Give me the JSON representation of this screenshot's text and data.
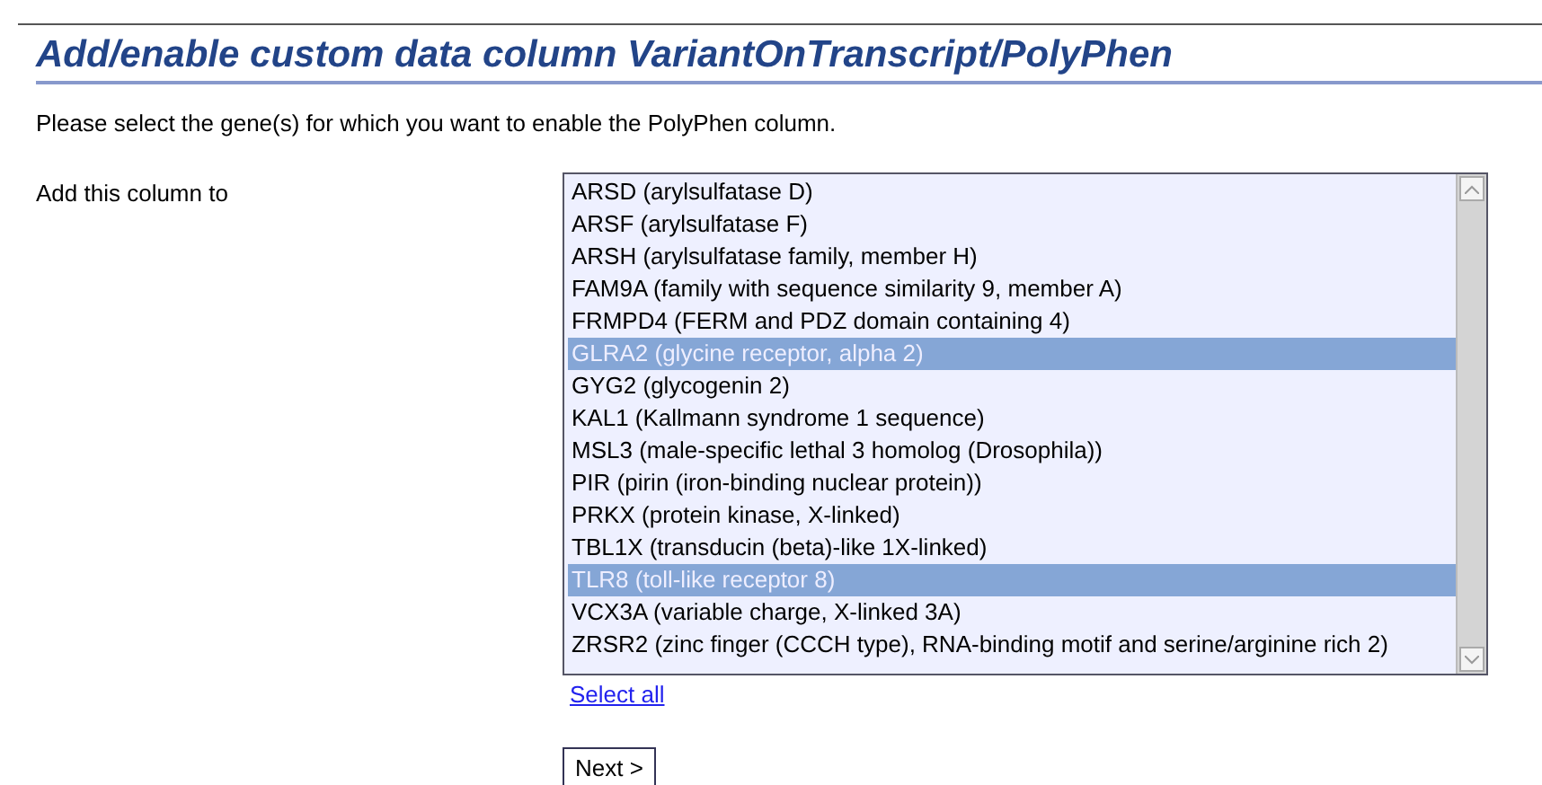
{
  "title": "Add/enable custom data column VariantOnTranscript/PolyPhen",
  "intro": "Please select the gene(s) for which you want to enable the PolyPhen column.",
  "field_label": "Add this column to",
  "genes": [
    {
      "label": "ARSD (arylsulfatase D)",
      "selected": false
    },
    {
      "label": "ARSF (arylsulfatase F)",
      "selected": false
    },
    {
      "label": "ARSH (arylsulfatase family, member H)",
      "selected": false
    },
    {
      "label": "FAM9A (family with sequence similarity 9, member A)",
      "selected": false
    },
    {
      "label": "FRMPD4 (FERM and PDZ domain containing 4)",
      "selected": false
    },
    {
      "label": "GLRA2 (glycine receptor, alpha 2)",
      "selected": true
    },
    {
      "label": "GYG2 (glycogenin 2)",
      "selected": false
    },
    {
      "label": "KAL1 (Kallmann syndrome 1 sequence)",
      "selected": false
    },
    {
      "label": "MSL3 (male-specific lethal 3 homolog (Drosophila))",
      "selected": false
    },
    {
      "label": "PIR (pirin (iron-binding nuclear protein))",
      "selected": false
    },
    {
      "label": "PRKX (protein kinase, X-linked)",
      "selected": false
    },
    {
      "label": "TBL1X (transducin (beta)-like 1X-linked)",
      "selected": false
    },
    {
      "label": "TLR8 (toll-like receptor 8)",
      "selected": true
    },
    {
      "label": "VCX3A (variable charge, X-linked 3A)",
      "selected": false
    },
    {
      "label": "ZRSR2 (zinc finger (CCCH type), RNA-binding motif and serine/arginine rich 2)",
      "selected": false
    }
  ],
  "select_all": "Select all",
  "next_button": "Next >"
}
